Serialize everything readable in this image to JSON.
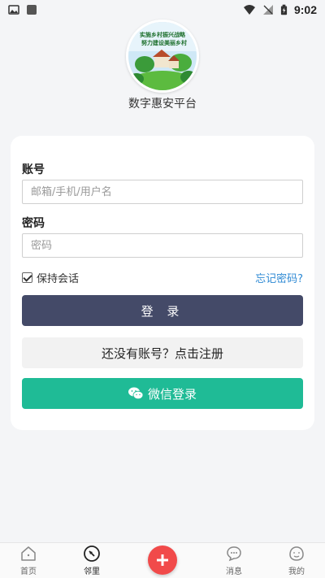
{
  "status_bar": {
    "time": "9:02"
  },
  "header": {
    "logo_text_line1": "实施乡村振兴战略",
    "logo_text_line2": "努力建设美丽乡村",
    "app_name": "数字惠安平台"
  },
  "form": {
    "account_label": "账号",
    "account_placeholder": "邮箱/手机/用户名",
    "account_value": "",
    "password_label": "密码",
    "password_placeholder": "密码",
    "password_value": "",
    "remember_label": "保持会话",
    "remember_checked": true,
    "forgot_label": "忘记密码?",
    "login_label": "登 录",
    "register_label": "还没有账号？点击注册",
    "wechat_label": "微信登录"
  },
  "bottom_nav": {
    "items": [
      {
        "label": "首页",
        "icon": "home-icon"
      },
      {
        "label": "邻里",
        "icon": "compass-icon",
        "active": true
      },
      {
        "label": "",
        "icon": "plus-icon"
      },
      {
        "label": "消息",
        "icon": "message-icon"
      },
      {
        "label": "我的",
        "icon": "user-icon"
      }
    ]
  },
  "colors": {
    "background": "#f4f5f7",
    "login_button": "#444a68",
    "wechat_button": "#1fbb96",
    "link": "#2f8ad4",
    "fab": "#f14a4a"
  }
}
